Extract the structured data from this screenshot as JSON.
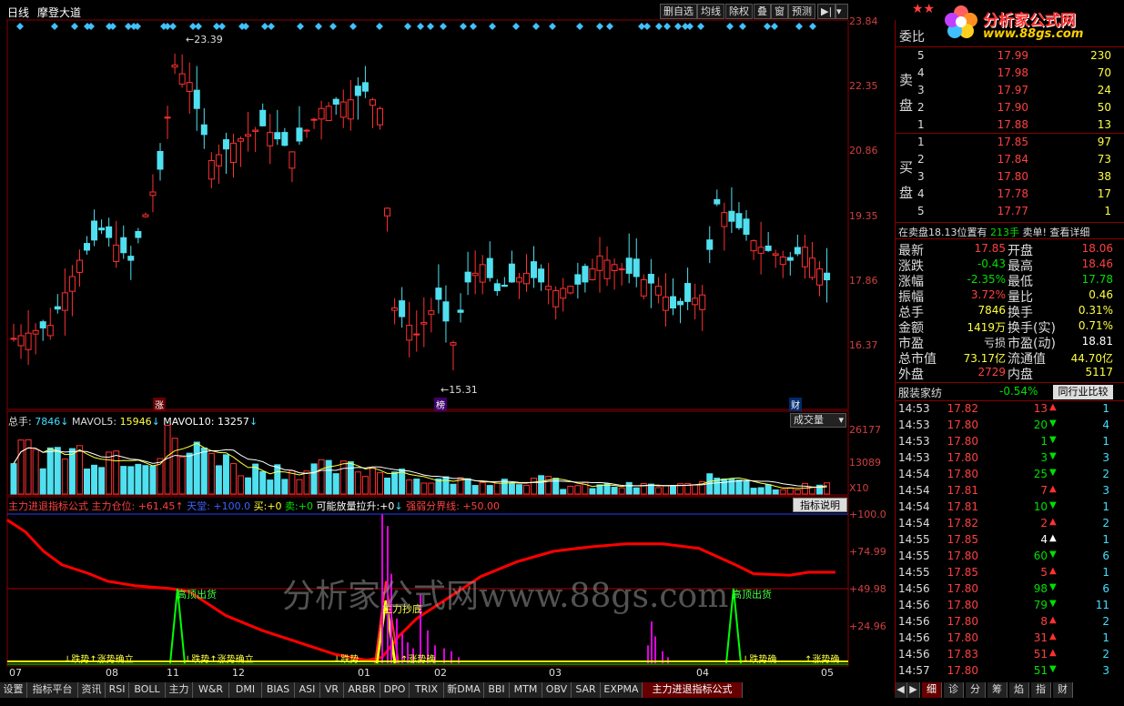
{
  "header": {
    "period": "日线",
    "indicator_name": "摩登大道",
    "buttons": [
      "删自选",
      "均线",
      "除权",
      "叠",
      "窗",
      "预测"
    ]
  },
  "price_axis": [
    "23.84",
    "22.35",
    "20.86",
    "19.35",
    "17.86",
    "16.37"
  ],
  "annotations": {
    "high": "23.39",
    "low": "15.31",
    "tag_zhang": "涨",
    "tag_bang": "榜",
    "tag_cai": "财"
  },
  "volume": {
    "legend_label": "总手:",
    "legend_value": "7846",
    "ma5_label": "MAVOL5:",
    "ma5_value": "15946",
    "ma10_label": "MAVOL10:",
    "ma10_value": "13257",
    "selector": "成交量",
    "axis": [
      "26177",
      "13089",
      "X10"
    ]
  },
  "indicator": {
    "name": "主力进退指标公式",
    "line1_label": "主力仓位:",
    "line1_value": "+61.45",
    "line2_label": "天堂:",
    "line2_value": "+100.0",
    "buy_label": "买:",
    "buy_value": "+0",
    "sell_label": "卖:",
    "sell_value": "+0",
    "vol_label": "可能放量拉升:",
    "vol_value": "+0",
    "strong_label": "强弱分界线:",
    "strong_value": "+50.00",
    "help_button": "指标说明",
    "axis": [
      "+100.0",
      "+74.99",
      "+49.98",
      "+24.96"
    ],
    "labels": {
      "top1": "高顶出货",
      "top2": "高顶出货",
      "bottom": "主力抄底",
      "trend1": "↓跌势",
      "trend1b": "↑涨势确立",
      "trend2": "↓跌势",
      "trend2b": "↑涨势确立",
      "trend3": "↓跌势",
      "trend3b": "↑涨势确",
      "trend4": "↓跌势确",
      "trend4b": "↑涨势确"
    }
  },
  "watermark": "分析家公式网www.88gs.com",
  "date_axis": [
    "07",
    "08",
    "11",
    "12",
    "01",
    "02",
    "03",
    "04",
    "05"
  ],
  "tabs": [
    "设置",
    "指标平台",
    "资讯",
    "RSI",
    "BOLL",
    "主力",
    "W&R",
    "DMI",
    "BIAS",
    "ASI",
    "VR",
    "ARBR",
    "DPO",
    "TRIX",
    "新DMA",
    "BBI",
    "MTM",
    "OBV",
    "SAR",
    "EXPMA",
    "主力进退指标公式"
  ],
  "right_tabs": [
    "细",
    "诊",
    "分",
    "筹",
    "焰",
    "指",
    "财"
  ],
  "panel": {
    "brand": "分析家公式网",
    "brand_url": "www.88gs.com",
    "webi_label": "委比",
    "sell_label": "卖盘",
    "buy_label": "买盘",
    "sells": [
      {
        "lvl": "5",
        "price": "17.99",
        "vol": "230"
      },
      {
        "lvl": "4",
        "price": "17.98",
        "vol": "70"
      },
      {
        "lvl": "3",
        "price": "17.97",
        "vol": "24"
      },
      {
        "lvl": "2",
        "price": "17.90",
        "vol": "50"
      },
      {
        "lvl": "1",
        "price": "17.88",
        "vol": "13"
      }
    ],
    "buys": [
      {
        "lvl": "1",
        "price": "17.85",
        "vol": "97"
      },
      {
        "lvl": "2",
        "price": "17.84",
        "vol": "73"
      },
      {
        "lvl": "3",
        "price": "17.80",
        "vol": "38"
      },
      {
        "lvl": "4",
        "price": "17.78",
        "vol": "17"
      },
      {
        "lvl": "5",
        "price": "17.77",
        "vol": "1"
      }
    ],
    "notice_a": "在卖盘18.13位置有",
    "notice_b": "213手",
    "notice_c": "卖单!",
    "notice_d": "查看详细",
    "quote": [
      [
        "最新",
        "17.85",
        "开盘",
        "18.06"
      ],
      [
        "涨跌",
        "-0.43",
        "最高",
        "18.46"
      ],
      [
        "涨幅",
        "-2.35%",
        "最低",
        "17.78"
      ],
      [
        "振幅",
        "3.72%",
        "量比",
        "0.46"
      ],
      [
        "总手",
        "7846",
        "换手",
        "0.31%"
      ],
      [
        "金额",
        "1419万",
        "换手(实)",
        "0.71%"
      ],
      [
        "市盈",
        "亏损",
        "市盈(动)",
        "18.81"
      ],
      [
        "总市值",
        "73.17亿",
        "流通值",
        "44.70亿"
      ],
      [
        "外盘",
        "2729",
        "内盘",
        "5117"
      ]
    ],
    "industry_name": "服装家纺",
    "industry_change": "-0.54%",
    "industry_button": "同行业比较",
    "ticks": [
      {
        "t": "14:53",
        "p": "17.82",
        "v": "13",
        "d": "up",
        "n": "1"
      },
      {
        "t": "14:53",
        "p": "17.80",
        "v": "20",
        "d": "down",
        "n": "4"
      },
      {
        "t": "14:53",
        "p": "17.80",
        "v": "1",
        "d": "down",
        "n": "1"
      },
      {
        "t": "14:53",
        "p": "17.80",
        "v": "3",
        "d": "down",
        "n": "3"
      },
      {
        "t": "14:54",
        "p": "17.80",
        "v": "25",
        "d": "down",
        "n": "2"
      },
      {
        "t": "14:54",
        "p": "17.81",
        "v": "7",
        "d": "up",
        "n": "3"
      },
      {
        "t": "14:54",
        "p": "17.81",
        "v": "10",
        "d": "down",
        "n": "1"
      },
      {
        "t": "14:54",
        "p": "17.82",
        "v": "2",
        "d": "up",
        "n": "2"
      },
      {
        "t": "14:55",
        "p": "17.85",
        "v": "4",
        "d": "neutral",
        "n": "1"
      },
      {
        "t": "14:55",
        "p": "17.80",
        "v": "60",
        "d": "down",
        "n": "6"
      },
      {
        "t": "14:55",
        "p": "17.85",
        "v": "5",
        "d": "up",
        "n": "1"
      },
      {
        "t": "14:56",
        "p": "17.80",
        "v": "98",
        "d": "down",
        "n": "6"
      },
      {
        "t": "14:56",
        "p": "17.80",
        "v": "79",
        "d": "down",
        "n": "11"
      },
      {
        "t": "14:56",
        "p": "17.80",
        "v": "8",
        "d": "up",
        "n": "2"
      },
      {
        "t": "14:56",
        "p": "17.80",
        "v": "31",
        "d": "up",
        "n": "1"
      },
      {
        "t": "14:56",
        "p": "17.83",
        "v": "51",
        "d": "up",
        "n": "2"
      },
      {
        "t": "14:57",
        "p": "17.80",
        "v": "51",
        "d": "down",
        "n": "3"
      }
    ]
  },
  "colors": {
    "up": "#ff3030",
    "down": "#50e0f0",
    "mainline": "#ff0000",
    "signal": "#00ff00",
    "vol_bar": "#e000e0"
  },
  "chart_data": {
    "type": "candlestick",
    "ylim": [
      15.31,
      23.84
    ],
    "high": 23.39,
    "low": 15.31
  }
}
